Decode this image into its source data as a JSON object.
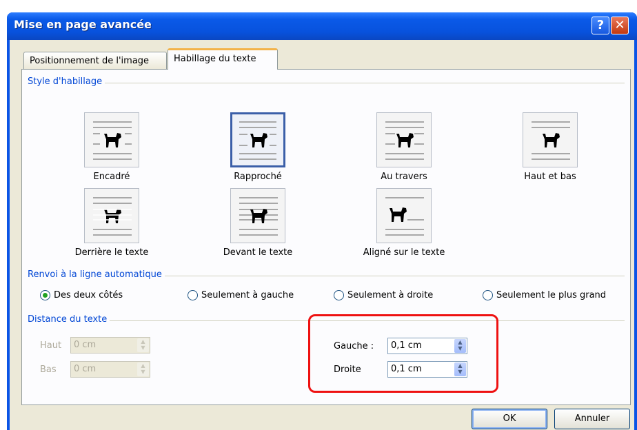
{
  "window": {
    "title": "Mise en page avancée",
    "help_label": "?",
    "close_label": "✕"
  },
  "tabs": [
    {
      "label": "Positionnement de l'image"
    },
    {
      "label": "Habillage du texte"
    }
  ],
  "wrap_style": {
    "group_label": "Style d'habillage",
    "options": [
      {
        "label": "Encadré",
        "icon": "square-wrap-icon",
        "selected": false
      },
      {
        "label": "Rapproché",
        "icon": "tight-wrap-icon",
        "selected": true
      },
      {
        "label": "Au travers",
        "icon": "through-wrap-icon",
        "selected": false
      },
      {
        "label": "Haut et bas",
        "icon": "top-bottom-wrap-icon",
        "selected": false
      },
      {
        "label": "Derrière le texte",
        "icon": "behind-text-icon",
        "selected": false
      },
      {
        "label": "Devant le texte",
        "icon": "in-front-text-icon",
        "selected": false
      },
      {
        "label": "Aligné sur le texte",
        "icon": "inline-text-icon",
        "selected": false
      }
    ]
  },
  "wrap_text": {
    "group_label": "Renvoi à la ligne automatique",
    "options": [
      {
        "label": "Des deux côtés",
        "selected": true
      },
      {
        "label": "Seulement à gauche",
        "selected": false
      },
      {
        "label": "Seulement à droite",
        "selected": false
      },
      {
        "label": "Seulement le plus grand",
        "selected": false
      }
    ]
  },
  "distance": {
    "group_label": "Distance du texte",
    "top": {
      "label": "Haut",
      "value": "0 cm"
    },
    "bottom": {
      "label": "Bas",
      "value": "0 cm"
    },
    "left": {
      "label": "Gauche :",
      "value": "0,1 cm"
    },
    "right": {
      "label": "Droite",
      "value": "0,1 cm"
    }
  },
  "buttons": {
    "ok": "OK",
    "cancel": "Annuler"
  },
  "colors": {
    "title_bar": "#0a54e6",
    "dialog_bg": "#ece9d8",
    "group_label": "#0046d5",
    "highlight": "#ee1111"
  }
}
